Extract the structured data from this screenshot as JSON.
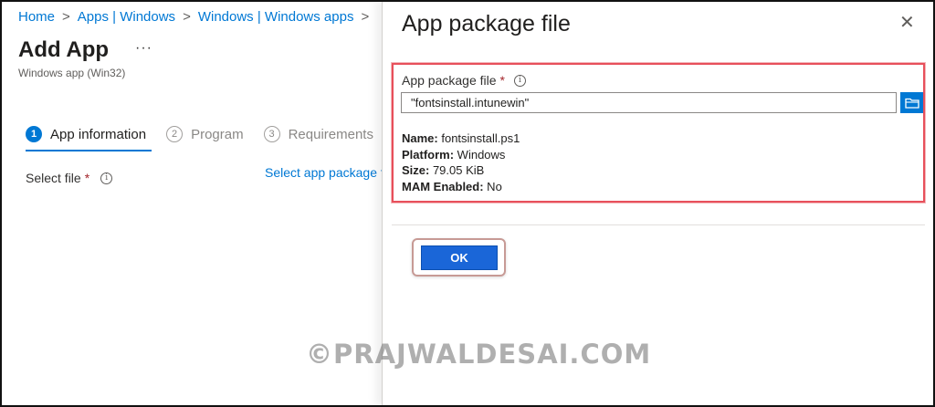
{
  "breadcrumb": {
    "items": [
      "Home",
      "Apps | Windows",
      "Windows | Windows apps"
    ],
    "separator": ">"
  },
  "page": {
    "title": "Add App",
    "more_label": "···",
    "subtitle": "Windows app (Win32)"
  },
  "steps": [
    {
      "number": "1",
      "label": "App information",
      "active": true
    },
    {
      "number": "2",
      "label": "Program",
      "active": false
    },
    {
      "number": "3",
      "label": "Requirements",
      "active": false
    }
  ],
  "form": {
    "select_file_label": "Select file",
    "required_mark": "*",
    "select_link": "Select app package fi"
  },
  "panel": {
    "title": "App package file",
    "close_glyph": "✕",
    "field_label": "App package file",
    "required_mark": "*",
    "input_value": "\"fontsinstall.intunewin\"",
    "details": [
      {
        "key": "Name:",
        "value": " fontsinstall.ps1"
      },
      {
        "key": "Platform:",
        "value": " Windows"
      },
      {
        "key": "Size:",
        "value": " 79.05 KiB"
      },
      {
        "key": "MAM Enabled:",
        "value": " No"
      }
    ],
    "ok_label": "OK"
  },
  "icons": {
    "info": "i",
    "chevron": ">"
  },
  "watermark": "©PRAJWALDESAI.COM",
  "colors": {
    "accent": "#0078d4",
    "highlight": "#e8505b",
    "required": "#a4262c"
  }
}
